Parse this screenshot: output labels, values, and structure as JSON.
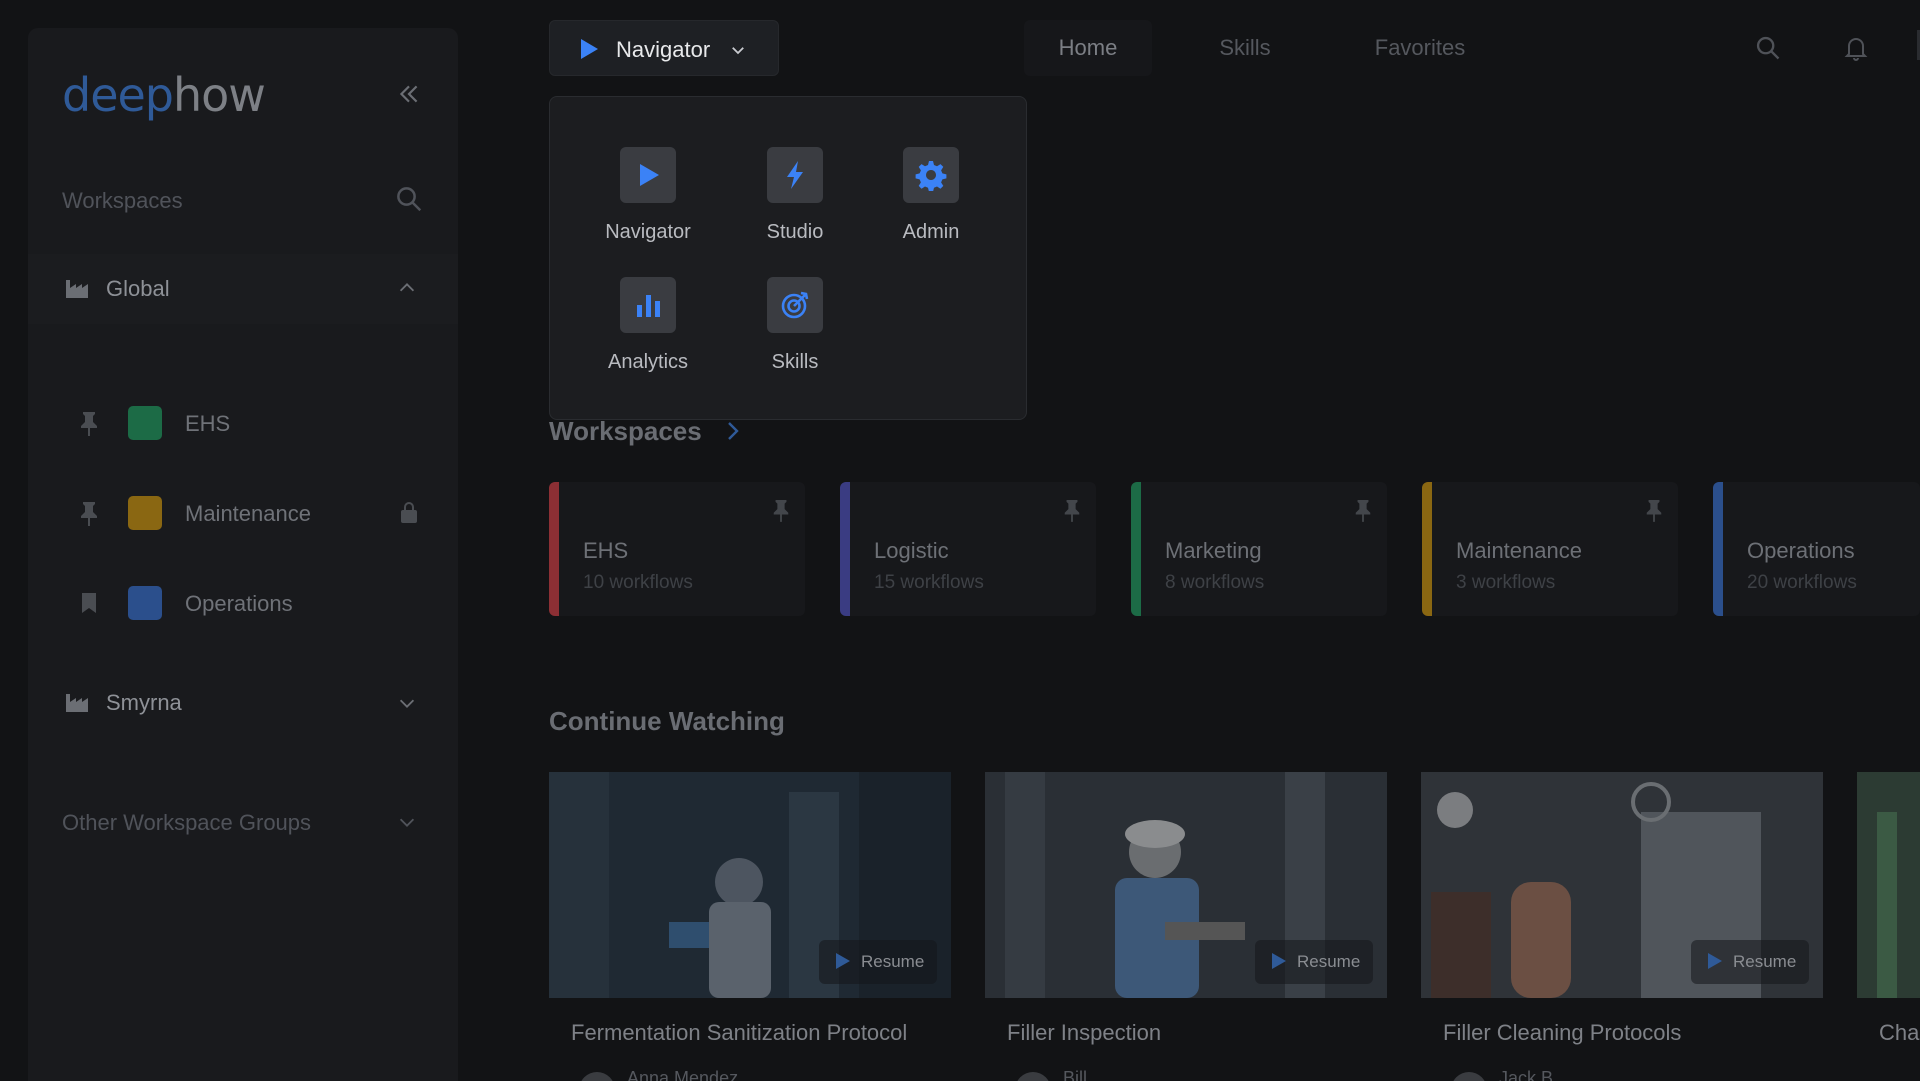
{
  "brand": {
    "part1": "deep",
    "part2": "how"
  },
  "sidebar": {
    "search_label": "Workspaces",
    "groups": [
      {
        "label": "Global",
        "expanded": true
      },
      {
        "label": "Smyrna",
        "expanded": false
      }
    ],
    "items": [
      {
        "label": "EHS",
        "color": "#1c6b46",
        "pin": "pin-icon",
        "locked": false
      },
      {
        "label": "Maintenance",
        "color": "#8a6712",
        "pin": "pin-icon",
        "locked": true
      },
      {
        "label": "Operations",
        "color": "#2b4f8c",
        "pin": "bookmark-icon",
        "locked": false
      }
    ],
    "other_groups_label": "Other Workspace Groups"
  },
  "topbar": {
    "app_label": "Navigator",
    "tabs": [
      {
        "label": "Home",
        "active": true
      },
      {
        "label": "Skills",
        "active": false
      },
      {
        "label": "Favorites",
        "active": false
      }
    ]
  },
  "app_menu": {
    "apps": [
      {
        "label": "Navigator",
        "icon": "play-icon"
      },
      {
        "label": "Studio",
        "icon": "bolt-icon"
      },
      {
        "label": "Admin",
        "icon": "gear-icon"
      },
      {
        "label": "Analytics",
        "icon": "bar-chart-icon"
      },
      {
        "label": "Skills",
        "icon": "target-icon"
      }
    ]
  },
  "workspaces": {
    "title": "Workspaces",
    "cards": [
      {
        "title": "EHS",
        "sub": "10 workflows",
        "color": "#8c2f34"
      },
      {
        "title": "Logistic",
        "sub": "15 workflows",
        "color": "#3a3c82"
      },
      {
        "title": "Marketing",
        "sub": "8 workflows",
        "color": "#1c6b46"
      },
      {
        "title": "Maintenance",
        "sub": "3 workflows",
        "color": "#8a6712"
      },
      {
        "title": "Operations",
        "sub": "20 workflows",
        "color": "#2b4f8c"
      }
    ]
  },
  "continue_watching": {
    "title": "Continue Watching",
    "resume_label": "Resume",
    "videos": [
      {
        "title": "Fermentation Sanitization Protocol",
        "author": "Anna Mendez"
      },
      {
        "title": "Filler Inspection",
        "author": "Bill"
      },
      {
        "title": "Filler Cleaning Protocols",
        "author": "Jack B"
      },
      {
        "title": "Cha",
        "author": ""
      }
    ]
  },
  "colors": {
    "accent": "#3b82f6",
    "background": "#121315"
  }
}
